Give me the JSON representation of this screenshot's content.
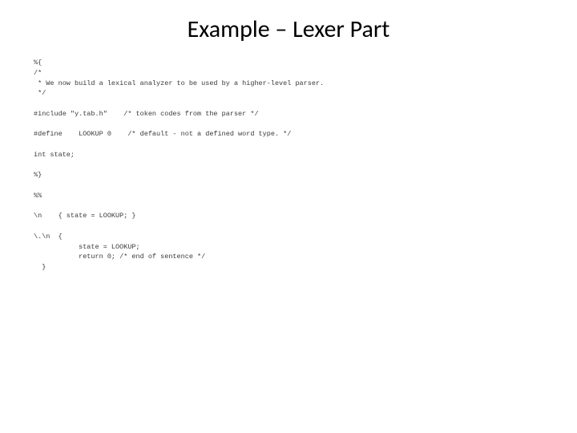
{
  "slide": {
    "title": "Example – Lexer Part",
    "code": "%{\n/*\n * We now build a lexical analyzer to be used by a higher-level parser.\n */\n\n#include \"y.tab.h\"    /* token codes from the parser */\n\n#define    LOOKUP 0    /* default - not a defined word type. */\n\nint state;\n\n%}\n\n%%\n\n\\n    { state = LOOKUP; }\n\n\\.\\n  {\n           state = LOOKUP;\n           return 0; /* end of sentence */\n  }"
  }
}
